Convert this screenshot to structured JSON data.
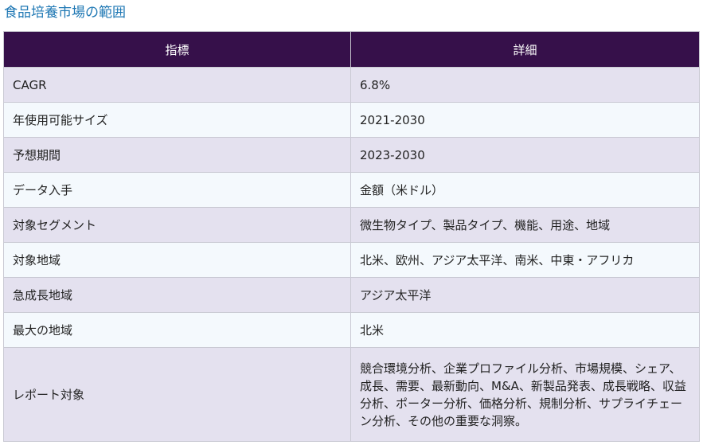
{
  "title": "食品培養市場の範囲",
  "table": {
    "headers": [
      "指標",
      "詳細"
    ],
    "rows": [
      {
        "label": "CAGR",
        "value": "6.8%"
      },
      {
        "label": "年使用可能サイズ",
        "value": "2021-2030"
      },
      {
        "label": "予想期間",
        "value": "2023-2030"
      },
      {
        "label": "データ入手",
        "value": "金額（米ドル）"
      },
      {
        "label": "対象セグメント",
        "value": "微生物タイプ、製品タイプ、機能、用途、地域"
      },
      {
        "label": "対象地域",
        "value": "北米、欧州、アジア太平洋、南米、中東・アフリカ"
      },
      {
        "label": "急成長地域",
        "value": "アジア太平洋"
      },
      {
        "label": "最大の地域",
        "value": "北米"
      },
      {
        "label": "レポート対象",
        "value": "競合環境分析、企業プロファイル分析、市場規模、シェア、成長、需要、最新動向、M&A、新製品発表、成長戦略、収益分析、ポーター分析、価格分析、規制分析、サプライチェーン分析、その他の重要な洞察。"
      }
    ]
  },
  "colors": {
    "title": "#1f78b4",
    "header_bg": "#36104a",
    "row_odd": "#e4e1ef",
    "row_even": "#f4f9fd"
  }
}
